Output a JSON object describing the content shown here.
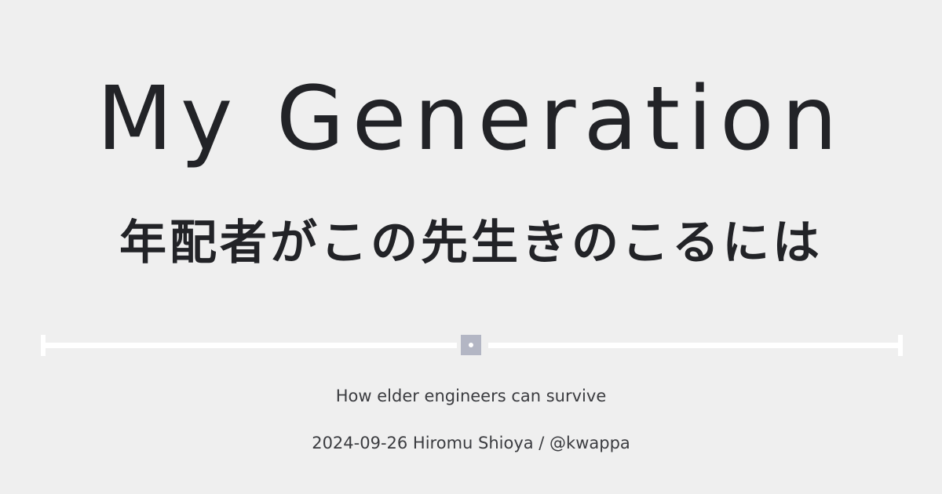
{
  "title": "My Generation",
  "subtitle": "年配者がこの先生きのこるには",
  "tagline": "How elder engineers can survive",
  "byline": "2024-09-26 Hiromu Shioya / @kwappa",
  "colors": {
    "background": "#efefef",
    "text": "#222327",
    "divider": "#ffffff",
    "divider_knob": "#b3b6c4"
  }
}
